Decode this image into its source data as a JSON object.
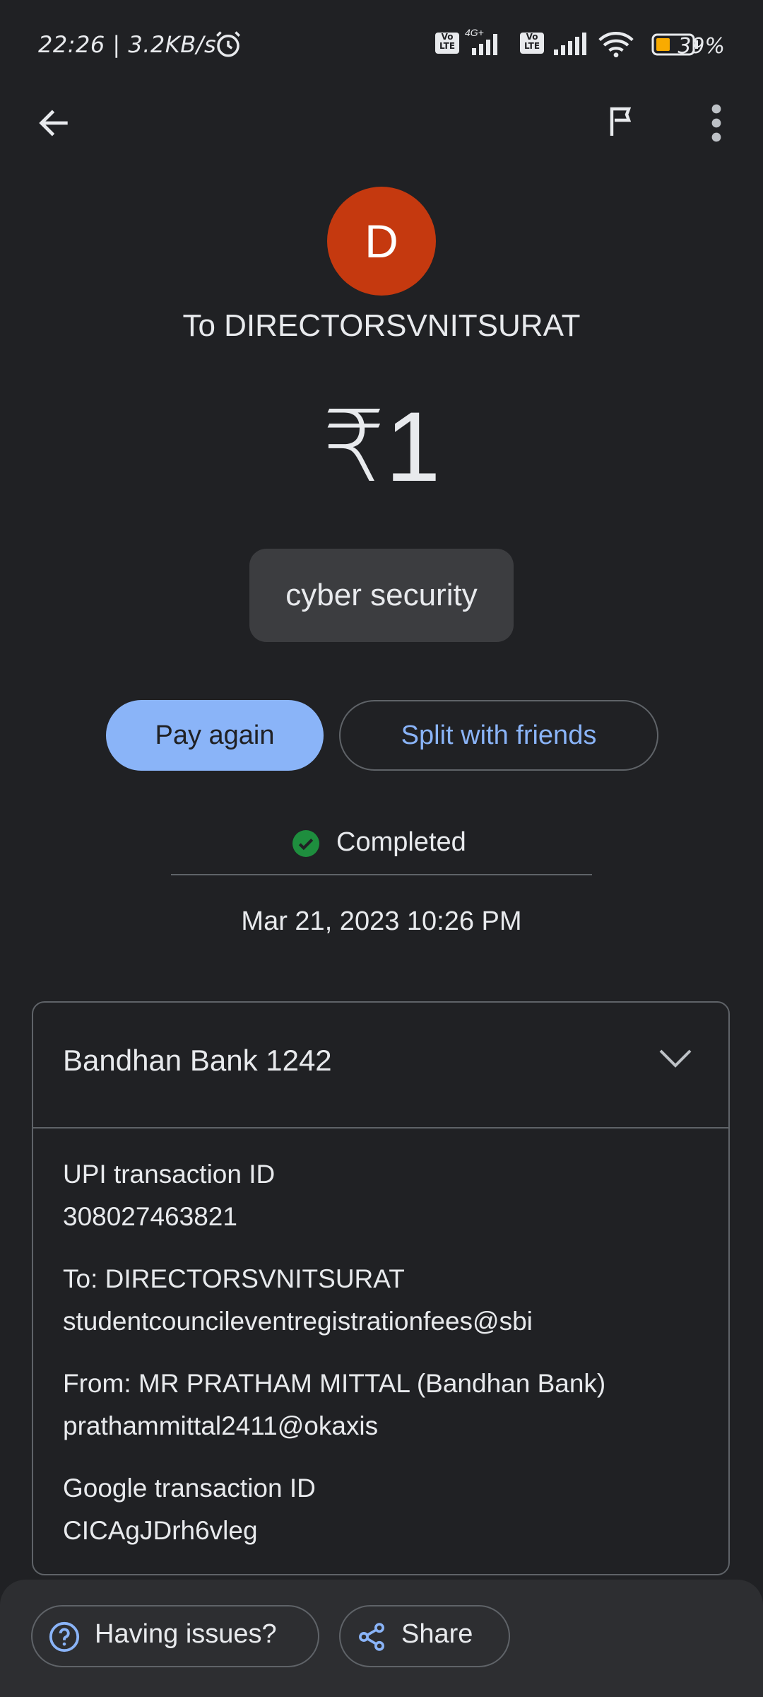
{
  "status_bar": {
    "time_speed": "22:26 | 3.2KB/s",
    "network_4g": "4G+",
    "volte_label": "Vo LTE",
    "battery_percent": "39%",
    "battery_level": 0.39,
    "icons": [
      "alarm-icon",
      "signal-icon",
      "wifi-icon",
      "battery-icon"
    ]
  },
  "toolbar": {
    "back_icon": "arrow-left",
    "report_icon": "flag",
    "more_icon": "more-vertical"
  },
  "payee": {
    "avatar_letter": "D",
    "avatar_color": "#c5390f",
    "recipient_line": "To DIRECTORSVNITSURAT"
  },
  "payment": {
    "amount": "₹1",
    "note": "cyber security"
  },
  "actions": {
    "pay_again": "Pay again",
    "split": "Split with friends"
  },
  "transaction_status": {
    "label": "Completed",
    "color": "#1e8e3e",
    "timestamp": "Mar 21, 2023 10:26 PM"
  },
  "details": {
    "bank": "Bandhan Bank 1242",
    "rows": [
      {
        "label": "UPI transaction ID",
        "value": "308027463821"
      },
      {
        "label": "To: DIRECTORSVNITSURAT",
        "value": "studentcouncileventregistrationfees@sbi"
      },
      {
        "label": "From: MR PRATHAM MITTAL (Bandhan Bank)",
        "value": "prathammittal2411@okaxis"
      },
      {
        "label": "Google transaction ID",
        "value": "CICAgJDrh6vleg"
      }
    ]
  },
  "bottom_bar": {
    "issues": "Having issues?",
    "share": "Share"
  },
  "theme": {
    "background": "#202124",
    "accent": "#8ab4f8"
  }
}
